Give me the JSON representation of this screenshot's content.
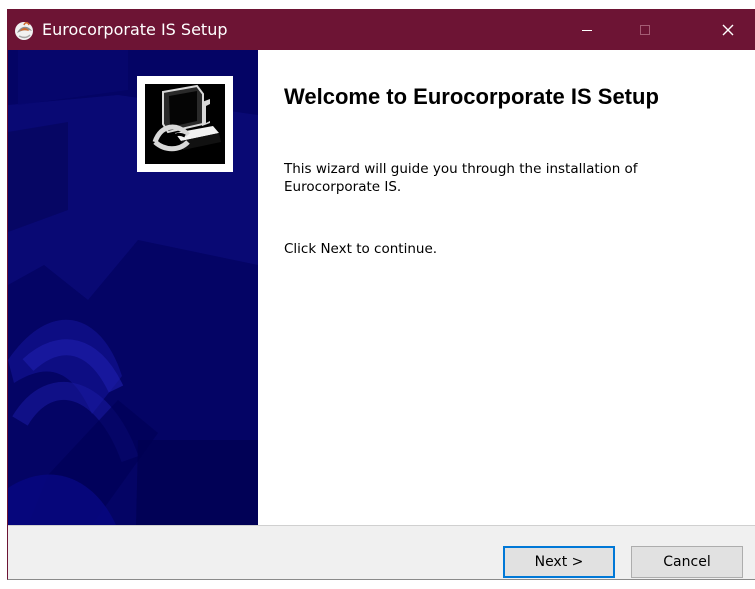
{
  "window": {
    "title": "Eurocorporate IS Setup",
    "app_icon": "installer-globe-icon",
    "controls": {
      "minimize_icon": "minimize-icon",
      "maximize_icon": "maximize-icon",
      "close_icon": "close-icon"
    }
  },
  "sidebar": {
    "logo_icon": "computer-installer-icon",
    "background_color": "#040465"
  },
  "welcome": {
    "heading": "Welcome to Eurocorporate IS Setup",
    "intro_line_1": "This wizard will guide you through the installation of",
    "intro_line_2": "Eurocorporate IS.",
    "continue_text": "Click Next to continue."
  },
  "footer": {
    "next_label": "Next >",
    "cancel_label": "Cancel"
  },
  "colors": {
    "titlebar": "#6d1434",
    "sidebar": "#040465",
    "focus": "#0078d7"
  }
}
